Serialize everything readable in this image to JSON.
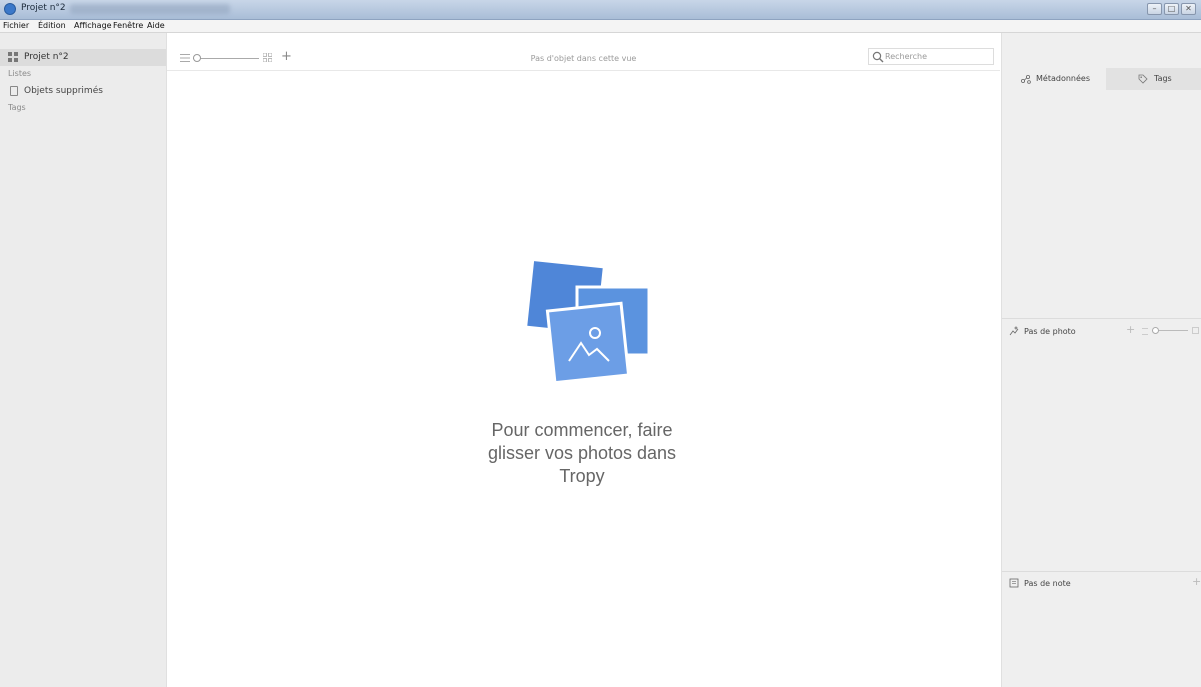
{
  "window": {
    "title": "Projet n°2",
    "buttons": {
      "minimize": "–",
      "maximize": "□",
      "close": "✕"
    }
  },
  "menu": {
    "items": [
      "Fichier",
      "Édition",
      "Affichage",
      "Fenêtre",
      "Aide"
    ]
  },
  "sidebar": {
    "project_label": "Projet n°2",
    "lists_heading": "Listes",
    "trash_label": "Objets supprimés",
    "tags_heading": "Tags"
  },
  "toolbar": {
    "status": "Pas d'objet dans cette vue",
    "search_placeholder": "Recherche",
    "add_symbol": "+"
  },
  "main": {
    "empty_line1": "Pour commencer, faire",
    "empty_line2": "glisser vos photos dans",
    "empty_line3": "Tropy"
  },
  "right_panel": {
    "tab_metadata": "Métadonnées",
    "tab_tags": "Tags",
    "photos_label": "Pas de photo",
    "notes_label": "Pas de note",
    "add_symbol": "+"
  },
  "colors": {
    "accent": "#5b93df",
    "photo_front": "#6c9ee6",
    "photo_back": "#4f86d8"
  }
}
